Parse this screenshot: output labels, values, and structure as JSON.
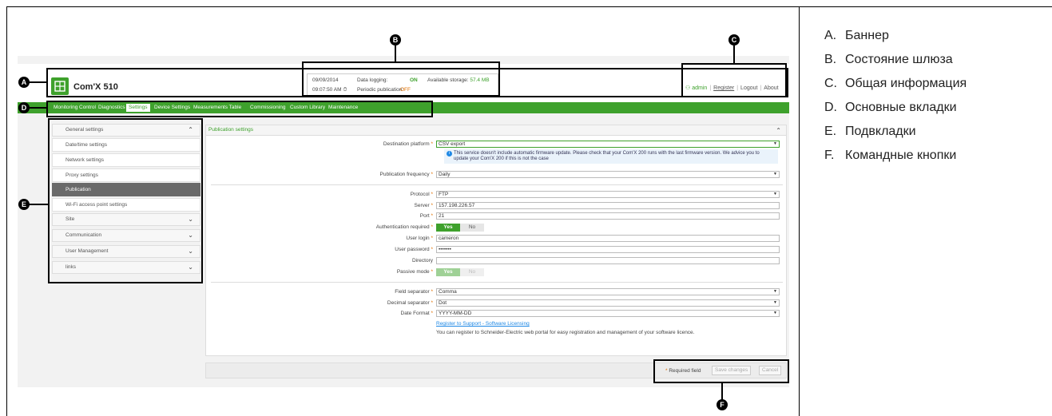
{
  "header": {
    "app_title": "Com'X 510",
    "status": {
      "date": "09/09/2014",
      "time": "09:07:50 AM",
      "data_logging_label": "Data logging:",
      "data_logging_value": "ON",
      "available_storage_label": "Available storage:",
      "available_storage_value": "57.4 MB",
      "periodic_publication_label": "Periodic publication:",
      "periodic_publication_value": "OFF"
    },
    "user": {
      "admin": "admin",
      "register": "Register",
      "logout": "Logout",
      "about": "About"
    }
  },
  "tabs": [
    "Monitoring",
    "Control",
    "Diagnostics",
    "Settings",
    "Device Settings",
    "Measurements Table",
    "Commissioning",
    "Custom Library",
    "Maintenance"
  ],
  "active_tab": "Settings",
  "sidebar": {
    "groups": {
      "general": "General settings",
      "site": "Site",
      "communication": "Communication",
      "user_management": "User Management",
      "links": "links"
    },
    "items": [
      "Date/time settings",
      "Network settings",
      "Proxy settings",
      "Publication",
      "Wi-Fi access point settings"
    ],
    "active_item": "Publication"
  },
  "panel": {
    "title": "Publication settings",
    "destination_platform": {
      "label": "Destination platform",
      "value": "CSV export"
    },
    "info": "This service doesn't include automatic firmware update. Please check that your Com'X 200 runs with the last firmware version. We advice you to update your Com'X 200 if this is not the case",
    "publication_frequency": {
      "label": "Publication frequency",
      "value": "Daily"
    },
    "protocol": {
      "label": "Protocol",
      "value": "FTP"
    },
    "server": {
      "label": "Server",
      "value": "157.198.226.57"
    },
    "port": {
      "label": "Port",
      "value": "21"
    },
    "authentication_required": {
      "label": "Authentication required",
      "yes": "Yes",
      "no": "No"
    },
    "user_login": {
      "label": "User login",
      "value": "cameron"
    },
    "user_password": {
      "label": "User password",
      "value": "•••••••"
    },
    "directory": {
      "label": "Directory",
      "value": ""
    },
    "passive_mode": {
      "label": "Passive mode",
      "yes": "Yes",
      "no": "No"
    },
    "field_separator": {
      "label": "Field separator",
      "value": "Comma"
    },
    "decimal_separator": {
      "label": "Decimal separator",
      "value": "Dot"
    },
    "date_format": {
      "label": "Date Format",
      "value": "YYYY-MM-DD"
    },
    "register_link": "Register to Support - Software Licensing",
    "register_note": "You can register to Schneider-Electric web portal for easy registration and management of your software licence.",
    "required_marker": "*"
  },
  "commands": {
    "required_field": "Required field",
    "save": "Save changes",
    "cancel": "Cancel"
  },
  "callouts": [
    "A",
    "B",
    "C",
    "D",
    "E",
    "F"
  ],
  "legend": [
    {
      "letter": "A.",
      "text": "Баннер"
    },
    {
      "letter": "B.",
      "text": "Состояние шлюза"
    },
    {
      "letter": "C.",
      "text": "Общая информация"
    },
    {
      "letter": "D.",
      "text": "Основные вкладки"
    },
    {
      "letter": "E.",
      "text": "Подвкладки"
    },
    {
      "letter": "F.",
      "text": "Командные кнопки"
    }
  ],
  "colors": {
    "brand_green": "#3ea12c",
    "warning_orange": "#e07000",
    "link_blue": "#1e88e5"
  }
}
